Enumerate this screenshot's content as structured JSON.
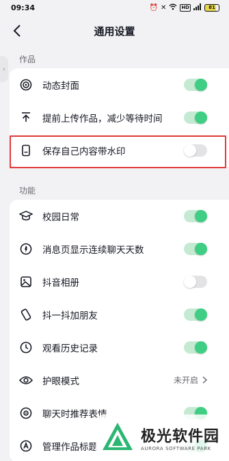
{
  "status_bar": {
    "time": "09:34",
    "network_badge": "HD",
    "battery": "81"
  },
  "header": {
    "title": "通用设置"
  },
  "sections": {
    "works": {
      "label": "作品",
      "items": [
        {
          "icon": "live-cover-icon",
          "label": "动态封面",
          "toggle": "on"
        },
        {
          "icon": "upload-icon",
          "label": "提前上传作品，减少等待时间",
          "toggle": "on"
        },
        {
          "icon": "phone-watermark-icon",
          "label": "保存自己内容带水印",
          "toggle": "off"
        }
      ]
    },
    "features": {
      "label": "功能",
      "items": [
        {
          "icon": "graduation-cap-icon",
          "label": "校园日常",
          "toggle": "on"
        },
        {
          "icon": "flame-icon",
          "label": "消息页显示连续聊天天数",
          "toggle": "on"
        },
        {
          "icon": "album-icon",
          "label": "抖音相册",
          "toggle": "off"
        },
        {
          "icon": "shake-phone-icon",
          "label": "抖一抖加朋友",
          "toggle": "on"
        },
        {
          "icon": "clock-icon",
          "label": "观看历史记录",
          "toggle": "on"
        },
        {
          "icon": "eye-icon",
          "label": "护眼模式",
          "value": "未开启"
        },
        {
          "icon": "emoji-icon",
          "label": "聊天时推荐表情",
          "toggle": "on"
        },
        {
          "icon": "title-icon",
          "label": "管理作品标题",
          "toggle": "on"
        }
      ]
    }
  },
  "watermark": {
    "title": "极光软件园",
    "subtitle": "AURORA SOFTWARE PARK"
  },
  "colors": {
    "toggle_on": "#3fce83",
    "toggle_off": "#e3e3e6",
    "highlight": "#e03a3a"
  }
}
